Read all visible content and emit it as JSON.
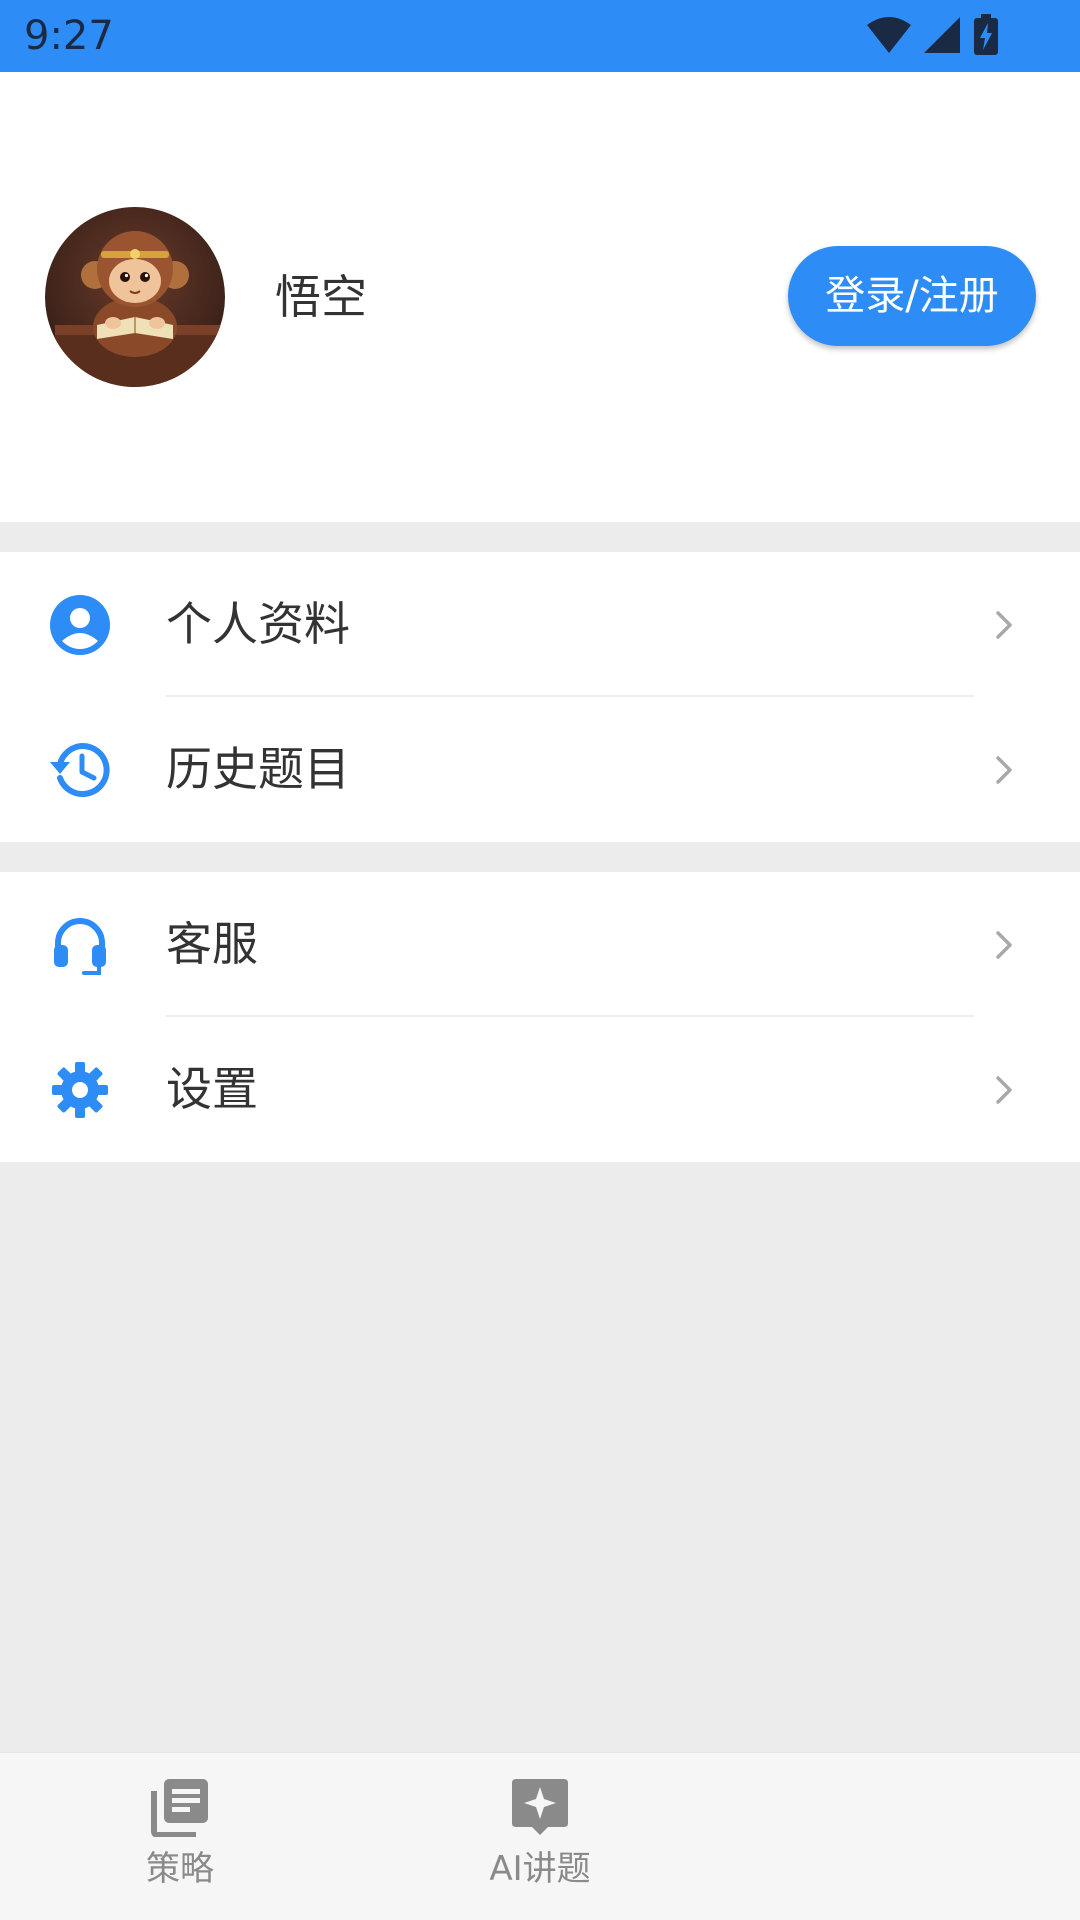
{
  "status_bar": {
    "time": "9:27",
    "background": "#2d8cf6",
    "icons": [
      "wifi-icon",
      "signal-icon",
      "battery-charging-icon"
    ]
  },
  "profile": {
    "username": "悟空",
    "login_label": "登录/注册",
    "avatar": "monkey-avatar"
  },
  "menu_groups": [
    {
      "items": [
        {
          "label": "个人资料",
          "icon": "user-circle-icon"
        },
        {
          "label": "历史题目",
          "icon": "history-icon"
        }
      ]
    },
    {
      "items": [
        {
          "label": "客服",
          "icon": "headset-icon"
        },
        {
          "label": "设置",
          "icon": "gear-icon"
        }
      ]
    }
  ],
  "bottom_nav": {
    "items": [
      {
        "label": "策略",
        "icon": "article-icon"
      },
      {
        "label": "AI讲题",
        "icon": "sparkle-icon"
      }
    ]
  },
  "colors": {
    "accent": "#2d8cf6",
    "text": "#333333",
    "background": "#ececec"
  }
}
